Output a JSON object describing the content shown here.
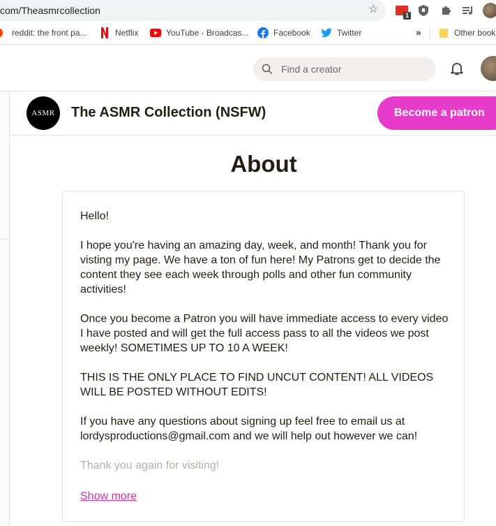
{
  "browser": {
    "url": "com/Theasmrcollection",
    "extension_badge": "1",
    "bookmarks": [
      {
        "label": "reddit: the front pa...",
        "icon": "reddit-icon"
      },
      {
        "label": "Netflix",
        "icon": "netflix-icon"
      },
      {
        "label": "YouTube - Broadcas...",
        "icon": "youtube-icon"
      },
      {
        "label": "Facebook",
        "icon": "facebook-icon"
      },
      {
        "label": "Twitter",
        "icon": "twitter-icon"
      }
    ],
    "more": "»",
    "other_bookmarks": "Other book"
  },
  "header": {
    "search_placeholder": "Find a creator"
  },
  "creator": {
    "logo_text": "ASMR",
    "name": "The ASMR Collection (NSFW)",
    "become_patron": "Become a patron"
  },
  "about": {
    "title": "About",
    "paragraphs": [
      "Hello!",
      "I hope you're having an amazing day, week, and month! Thank you for visting my page. We have a ton of fun here! My Patrons get to decide the content they see each week through polls and other fun community activities!",
      "Once you become a Patron you will have immediate access to every video I have posted and will get the full access pass to all the videos we post weekly! SOMETIMES UP TO 10 A WEEK!",
      "THIS IS THE ONLY PLACE TO FIND UNCUT CONTENT! ALL VIDEOS WILL BE POSTED WITHOUT EDITS!",
      "If you have any questions about signing up feel free to email us at lordysproductions@gmail.com and we will help out however we can!",
      "Thank you again for visiting!"
    ],
    "show_more": "Show more"
  },
  "colors": {
    "accent": "#e63bcb",
    "link": "#c436ab",
    "text": "#241e12"
  }
}
